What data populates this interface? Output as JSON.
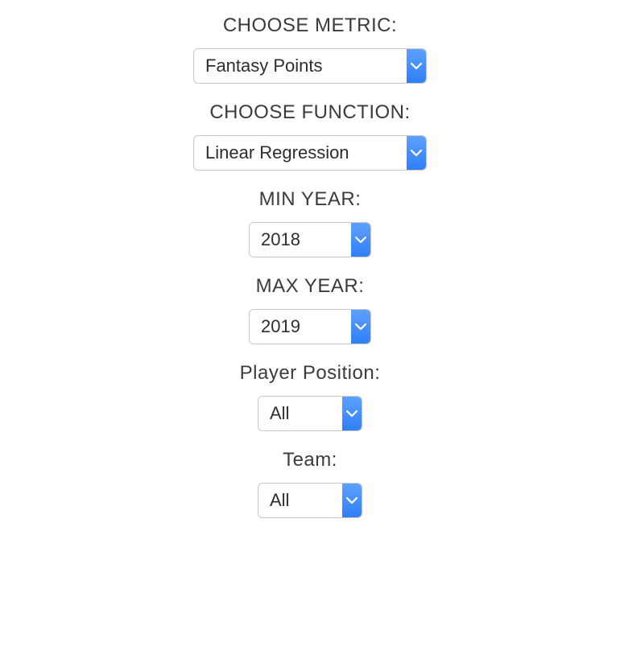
{
  "fields": {
    "metric": {
      "label": "Choose Metric:",
      "value": "Fantasy Points"
    },
    "function": {
      "label": "Choose Function:",
      "value": "Linear Regression"
    },
    "min_year": {
      "label": "Min Year:",
      "value": "2018"
    },
    "max_year": {
      "label": "Max Year:",
      "value": "2019"
    },
    "player_position": {
      "label": "Player Position:",
      "value": "All"
    },
    "team": {
      "label": "Team:",
      "value": "All"
    }
  },
  "icons": {
    "chevron_down": "chevron-down-icon"
  },
  "colors": {
    "button_top": "#5ea0ff",
    "button_bottom": "#2f7ff6",
    "chevron": "#ffffff",
    "border": "#c9c9c9",
    "text": "#2d2d2d",
    "label": "#3b3b3b",
    "bg": "#ffffff"
  }
}
